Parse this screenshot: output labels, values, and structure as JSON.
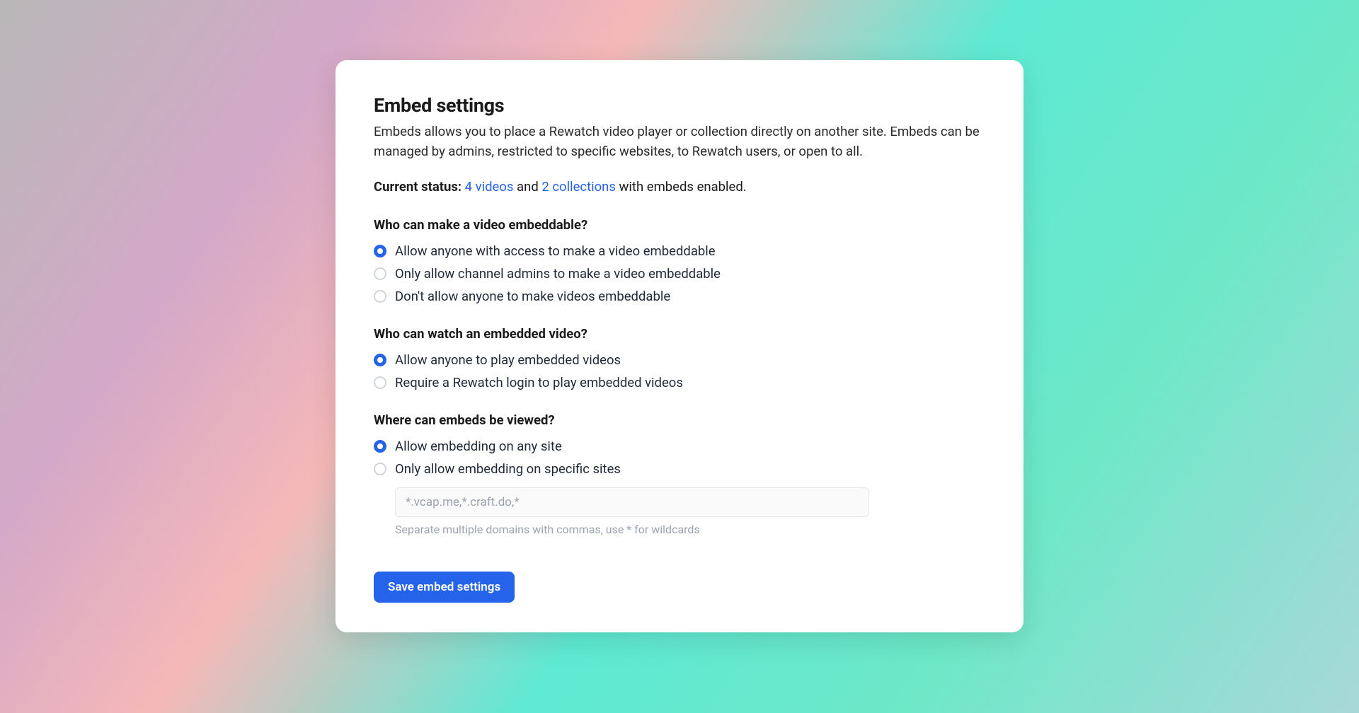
{
  "header": {
    "title": "Embed settings",
    "description": "Embeds allows you to place a Rewatch video player or collection directly on another site. Embeds can be managed by admins, restricted to specific websites, to Rewatch users, or open to all."
  },
  "status": {
    "label": "Current status:",
    "videos_link": "4 videos",
    "and_text": " and ",
    "collections_link": "2 collections",
    "suffix": " with embeds enabled."
  },
  "sections": {
    "who_embeddable": {
      "title": "Who can make a video embeddable?",
      "options": [
        {
          "label": "Allow anyone with access to make a video embeddable",
          "selected": true
        },
        {
          "label": "Only allow channel admins to make a video embeddable",
          "selected": false
        },
        {
          "label": "Don't allow anyone to make videos embeddable",
          "selected": false
        }
      ]
    },
    "who_watch": {
      "title": "Who can watch an embedded video?",
      "options": [
        {
          "label": "Allow anyone to play embedded videos",
          "selected": true
        },
        {
          "label": "Require a Rewatch login to play embedded videos",
          "selected": false
        }
      ]
    },
    "where_viewed": {
      "title": "Where can embeds be viewed?",
      "options": [
        {
          "label": "Allow embedding on any site",
          "selected": true
        },
        {
          "label": "Only allow embedding on specific sites",
          "selected": false
        }
      ],
      "domain_placeholder": "*.vcap.me,*.craft.do,*",
      "domain_hint": "Separate multiple domains with commas, use * for wildcards"
    }
  },
  "actions": {
    "save_label": "Save embed settings"
  }
}
